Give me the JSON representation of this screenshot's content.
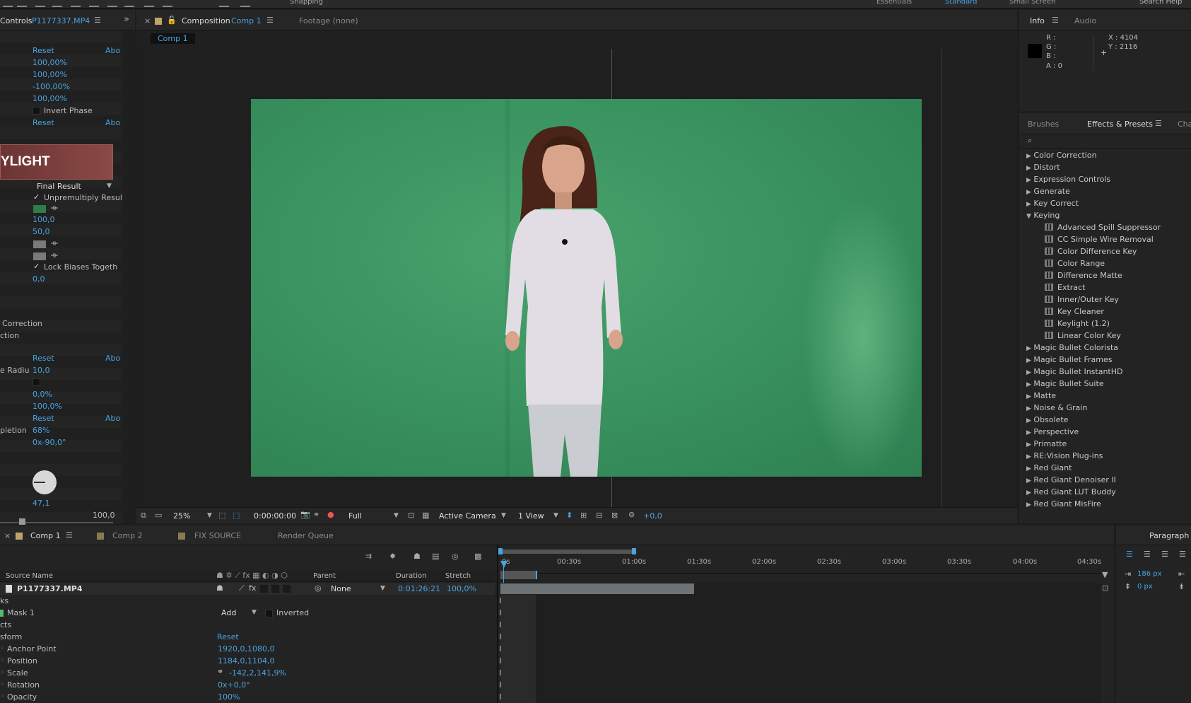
{
  "topbar": {
    "snapping": "Snapping",
    "workspaces": [
      "Essentials",
      "Standard",
      "Small Screen"
    ],
    "search": "Search Help"
  },
  "effect_controls": {
    "title": "Controls",
    "layer": "P1177337.MP4",
    "rows": [
      {
        "label": "",
        "value": "Reset",
        "extra": "Abo"
      },
      {
        "label": "",
        "value": "100,00%"
      },
      {
        "label": "",
        "value": "100,00%"
      },
      {
        "label": "",
        "value": "-100,00%"
      },
      {
        "label": "",
        "value": "100,00%"
      }
    ],
    "invert_phase": "Invert Phase",
    "reset2": "Reset",
    "abo2": "Abo",
    "logo_text": "YLIGHT",
    "view_mode": "Final Result",
    "unpremultiply": "Unpremultiply Resul",
    "v100": "100,0",
    "v50": "50,0",
    "lock_biases": "Lock Biases Togeth",
    "v0": "0,0",
    "correction": "Correction",
    "ction": "ction",
    "reset3": "Reset",
    "abo3": "Abo",
    "radius_label": "e Radiu",
    "radius_value": "10,0",
    "pct0": "0,0%",
    "pct100": "100,0%",
    "reset4": "Reset",
    "abo4": "Abo",
    "depletion_label": "pletion",
    "depletion_value": "68%",
    "angle_value": "0x-90,0°",
    "slider_value": "47,1",
    "slider_max": "100,0",
    "swatch_green": "#2e7d48",
    "swatch_gray": "#7a7a7a"
  },
  "composition": {
    "tab_label": "Composition",
    "tab_comp": "Comp 1",
    "footage_tab": "Footage (none)",
    "sub_tab": "Comp 1",
    "zoom": "25%",
    "timecode": "0:00:00:00",
    "resolution": "Full",
    "camera": "Active Camera",
    "view": "1 View",
    "exposure": "+0,0",
    "green_color": "#3e9a62"
  },
  "info": {
    "tab": "Info",
    "audio_tab": "Audio",
    "r": "R :",
    "g": "G :",
    "b": "B :",
    "a": "A : 0",
    "x": "X : 4104",
    "y": "Y : 2116"
  },
  "effects_presets": {
    "brushes_tab": "Brushes",
    "tab": "Effects & Presets",
    "char_tab": "Cha",
    "categories_top": [
      "Color Correction",
      "Distort",
      "Expression Controls",
      "Generate",
      "Key Correct"
    ],
    "keying": "Keying",
    "keying_items": [
      "Advanced Spill Suppressor",
      "CC Simple Wire Removal",
      "Color Difference Key",
      "Color Range",
      "Difference Matte",
      "Extract",
      "Inner/Outer Key",
      "Key Cleaner",
      "Keylight (1.2)",
      "Linear Color Key"
    ],
    "categories_bottom": [
      "Magic Bullet Colorista",
      "Magic Bullet Frames",
      "Magic Bullet InstantHD",
      "Magic Bullet Suite",
      "Matte",
      "Noise & Grain",
      "Obsolete",
      "Perspective",
      "Primatte",
      "RE:Vision Plug-ins",
      "Red Giant",
      "Red Giant Denoiser II",
      "Red Giant LUT Buddy",
      "Red Giant MisFire"
    ]
  },
  "timeline": {
    "tabs": [
      "Comp 1",
      "Comp 2",
      "FIX SOURCE",
      "Render Queue"
    ],
    "paragraph": "Paragraph",
    "col_source": "Source Name",
    "col_parent": "Parent",
    "col_duration": "Duration",
    "col_stretch": "Stretch",
    "layer_name": "P1177337.MP4",
    "parent_value": "None",
    "duration_value": "0:01:26:21",
    "stretch_value": "100,0%",
    "ks": "ks",
    "mask": "Mask 1",
    "mask_mode": "Add",
    "inverted": "Inverted",
    "cts": "cts",
    "transform": "sform",
    "transform_reset": "Reset",
    "props": [
      {
        "label": "Anchor Point",
        "value": "1920,0,1080,0"
      },
      {
        "label": "Position",
        "value": "1184,0,1104,0"
      },
      {
        "label": "Scale",
        "value": "-142,2,141,9%"
      },
      {
        "label": "Rotation",
        "value": "0x+0,0°"
      },
      {
        "label": "Opacity",
        "value": "100%"
      }
    ],
    "ruler": [
      "0s",
      "00:30s",
      "01:00s",
      "01:30s",
      "02:00s",
      "02:30s",
      "03:00s",
      "03:30s",
      "04:00s",
      "04:30s"
    ],
    "para_px1": "186 px",
    "para_px2": "0 px"
  }
}
